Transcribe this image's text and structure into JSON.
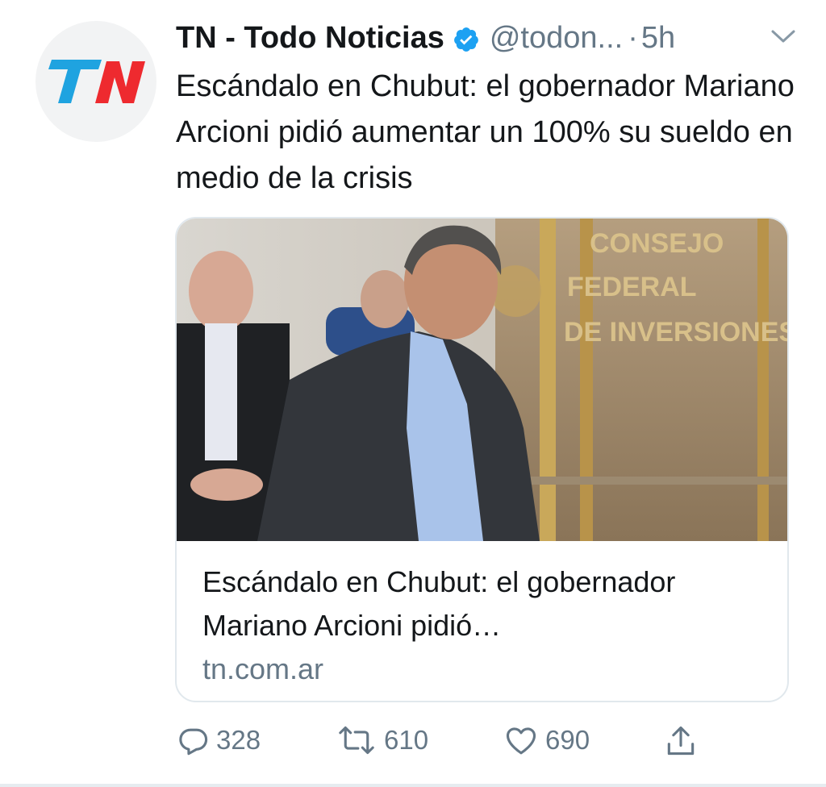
{
  "tweet": {
    "display_name": "TN - Todo Noticias",
    "handle": "@todon...",
    "separator": "·",
    "time": "5h",
    "text": "Escándalo en Chubut: el gobernador Mariano Arcioni pidió aumentar un 100% su sueldo en medio de la crisis",
    "verified": true,
    "avatar_logo": "TN"
  },
  "card": {
    "image_text": {
      "line1": "CONSEJO",
      "line2": "FEDERAL",
      "line3": "DE INVERSIONES"
    },
    "title": "Escándalo en Chubut: el gobernador Mariano Arcioni pidió…",
    "domain": "tn.com.ar"
  },
  "actions": {
    "reply_count": "328",
    "retweet_count": "610",
    "like_count": "690",
    "icons": [
      "reply-icon",
      "retweet-icon",
      "like-icon",
      "share-icon"
    ]
  },
  "colors": {
    "verified_blue": "#1da1f2",
    "logo_blue": "#1fa3e0",
    "logo_red": "#ee2a2f",
    "secondary_text": "#657786"
  }
}
